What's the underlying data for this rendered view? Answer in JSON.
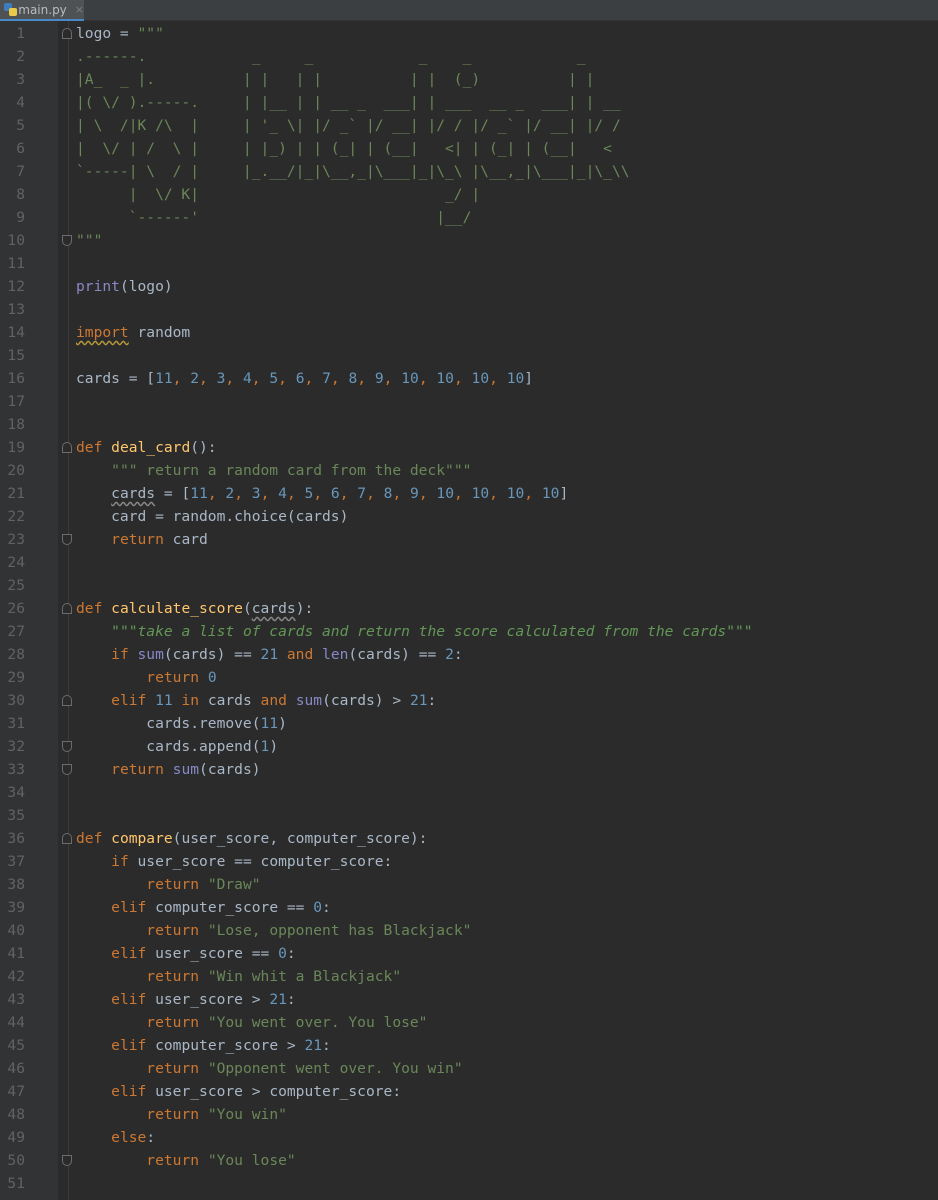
{
  "tab": {
    "filename": "main.py",
    "close": "×",
    "icon": "python-file-icon"
  },
  "lines": [
    {
      "n": "1",
      "segs": [
        [
          "t",
          "logo = "
        ],
        [
          "s",
          "\"\"\""
        ]
      ]
    },
    {
      "n": "2",
      "segs": [
        [
          "s",
          ".------.            _     _            _    _            _"
        ]
      ]
    },
    {
      "n": "3",
      "segs": [
        [
          "s",
          "|A_  _ |.          | |   | |          | |  (_)          | |"
        ]
      ]
    },
    {
      "n": "4",
      "segs": [
        [
          "s",
          "|( \\/ ).-----.     | |__ | | __ _  ___| | ___  __ _  ___| | __"
        ]
      ]
    },
    {
      "n": "5",
      "segs": [
        [
          "s",
          "| \\  /|K /\\  |     | '_ \\| |/ _` |/ __| |/ / |/ _` |/ __| |/ /"
        ]
      ]
    },
    {
      "n": "6",
      "segs": [
        [
          "s",
          "|  \\/ | /  \\ |     | |_) | | (_| | (__|   <| | (_| | (__|   <"
        ]
      ]
    },
    {
      "n": "7",
      "segs": [
        [
          "s",
          "`-----| \\  / |     |_.__/|_|\\__,_|\\___|_|\\_\\ |\\__,_|\\___|_|\\_\\\\"
        ]
      ]
    },
    {
      "n": "8",
      "segs": [
        [
          "s",
          "      |  \\/ K|                            _/ |"
        ]
      ]
    },
    {
      "n": "9",
      "segs": [
        [
          "s",
          "      `------'                           |__/"
        ]
      ]
    },
    {
      "n": "10",
      "segs": [
        [
          "s",
          "\"\"\""
        ]
      ]
    },
    {
      "n": "11",
      "segs": []
    },
    {
      "n": "12",
      "segs": [
        [
          "b",
          "print"
        ],
        [
          "t",
          "(logo)"
        ]
      ]
    },
    {
      "n": "13",
      "segs": []
    },
    {
      "n": "14",
      "segs": [
        [
          "kw-wavy",
          "import"
        ],
        [
          "t",
          " random"
        ]
      ]
    },
    {
      "n": "15",
      "segs": []
    },
    {
      "n": "16",
      "segs": [
        [
          "t",
          "cards = ["
        ],
        [
          "n",
          "11"
        ],
        [
          "k",
          ", "
        ],
        [
          "n",
          "2"
        ],
        [
          "k",
          ", "
        ],
        [
          "n",
          "3"
        ],
        [
          "k",
          ", "
        ],
        [
          "n",
          "4"
        ],
        [
          "k",
          ", "
        ],
        [
          "n",
          "5"
        ],
        [
          "k",
          ", "
        ],
        [
          "n",
          "6"
        ],
        [
          "k",
          ", "
        ],
        [
          "n",
          "7"
        ],
        [
          "k",
          ", "
        ],
        [
          "n",
          "8"
        ],
        [
          "k",
          ", "
        ],
        [
          "n",
          "9"
        ],
        [
          "k",
          ", "
        ],
        [
          "n",
          "10"
        ],
        [
          "k",
          ", "
        ],
        [
          "n",
          "10"
        ],
        [
          "k",
          ", "
        ],
        [
          "n",
          "10"
        ],
        [
          "k",
          ", "
        ],
        [
          "n",
          "10"
        ],
        [
          "t",
          "]"
        ]
      ]
    },
    {
      "n": "17",
      "segs": []
    },
    {
      "n": "18",
      "segs": []
    },
    {
      "n": "19",
      "segs": [
        [
          "k",
          "def "
        ],
        [
          "f",
          "deal_card"
        ],
        [
          "t",
          "():"
        ]
      ]
    },
    {
      "n": "20",
      "segs": [
        [
          "t",
          "    "
        ],
        [
          "s",
          "\"\"\" return a random card from the deck\"\"\""
        ]
      ]
    },
    {
      "n": "21",
      "segs": [
        [
          "t",
          "    "
        ],
        [
          "t-wavy",
          "cards"
        ],
        [
          "t",
          " = ["
        ],
        [
          "n",
          "11"
        ],
        [
          "k",
          ", "
        ],
        [
          "n",
          "2"
        ],
        [
          "k",
          ", "
        ],
        [
          "n",
          "3"
        ],
        [
          "k",
          ", "
        ],
        [
          "n",
          "4"
        ],
        [
          "k",
          ", "
        ],
        [
          "n",
          "5"
        ],
        [
          "k",
          ", "
        ],
        [
          "n",
          "6"
        ],
        [
          "k",
          ", "
        ],
        [
          "n",
          "7"
        ],
        [
          "k",
          ", "
        ],
        [
          "n",
          "8"
        ],
        [
          "k",
          ", "
        ],
        [
          "n",
          "9"
        ],
        [
          "k",
          ", "
        ],
        [
          "n",
          "10"
        ],
        [
          "k",
          ", "
        ],
        [
          "n",
          "10"
        ],
        [
          "k",
          ", "
        ],
        [
          "n",
          "10"
        ],
        [
          "k",
          ", "
        ],
        [
          "n",
          "10"
        ],
        [
          "t",
          "]"
        ]
      ]
    },
    {
      "n": "22",
      "segs": [
        [
          "t",
          "    card = random.choice(cards)"
        ]
      ]
    },
    {
      "n": "23",
      "segs": [
        [
          "t",
          "    "
        ],
        [
          "k",
          "return"
        ],
        [
          "t",
          " card"
        ]
      ]
    },
    {
      "n": "24",
      "segs": []
    },
    {
      "n": "25",
      "segs": []
    },
    {
      "n": "26",
      "segs": [
        [
          "k",
          "def "
        ],
        [
          "f",
          "calculate_score"
        ],
        [
          "t",
          "("
        ],
        [
          "t-wavy",
          "cards"
        ],
        [
          "t",
          "):"
        ]
      ]
    },
    {
      "n": "27",
      "segs": [
        [
          "t",
          "    "
        ],
        [
          "d",
          "\"\"\"take a list of cards and return the score calculated from the cards\"\"\""
        ]
      ]
    },
    {
      "n": "28",
      "segs": [
        [
          "t",
          "    "
        ],
        [
          "k",
          "if "
        ],
        [
          "b",
          "sum"
        ],
        [
          "t",
          "(cards) == "
        ],
        [
          "n",
          "21"
        ],
        [
          "k",
          " and "
        ],
        [
          "b",
          "len"
        ],
        [
          "t",
          "(cards) == "
        ],
        [
          "n",
          "2"
        ],
        [
          "t",
          ":"
        ]
      ]
    },
    {
      "n": "29",
      "segs": [
        [
          "t",
          "        "
        ],
        [
          "k",
          "return "
        ],
        [
          "n",
          "0"
        ]
      ]
    },
    {
      "n": "30",
      "segs": [
        [
          "t",
          "    "
        ],
        [
          "k",
          "elif "
        ],
        [
          "n",
          "11"
        ],
        [
          "k",
          " in"
        ],
        [
          "t",
          " cards "
        ],
        [
          "k",
          "and "
        ],
        [
          "b",
          "sum"
        ],
        [
          "t",
          "(cards) > "
        ],
        [
          "n",
          "21"
        ],
        [
          "t",
          ":"
        ]
      ]
    },
    {
      "n": "31",
      "segs": [
        [
          "t",
          "        cards.remove("
        ],
        [
          "n",
          "11"
        ],
        [
          "t",
          ")"
        ]
      ]
    },
    {
      "n": "32",
      "segs": [
        [
          "t",
          "        cards.append("
        ],
        [
          "n",
          "1"
        ],
        [
          "t",
          ")"
        ]
      ]
    },
    {
      "n": "33",
      "segs": [
        [
          "t",
          "    "
        ],
        [
          "k",
          "return "
        ],
        [
          "b",
          "sum"
        ],
        [
          "t",
          "(cards)"
        ]
      ]
    },
    {
      "n": "34",
      "segs": []
    },
    {
      "n": "35",
      "segs": []
    },
    {
      "n": "36",
      "segs": [
        [
          "k",
          "def "
        ],
        [
          "f",
          "compare"
        ],
        [
          "t",
          "(user_score, computer_score):"
        ]
      ]
    },
    {
      "n": "37",
      "segs": [
        [
          "t",
          "    "
        ],
        [
          "k",
          "if"
        ],
        [
          "t",
          " user_score == computer_score:"
        ]
      ]
    },
    {
      "n": "38",
      "segs": [
        [
          "t",
          "        "
        ],
        [
          "k",
          "return "
        ],
        [
          "s",
          "\"Draw\""
        ]
      ]
    },
    {
      "n": "39",
      "segs": [
        [
          "t",
          "    "
        ],
        [
          "k",
          "elif"
        ],
        [
          "t",
          " computer_score == "
        ],
        [
          "n",
          "0"
        ],
        [
          "t",
          ":"
        ]
      ]
    },
    {
      "n": "40",
      "segs": [
        [
          "t",
          "        "
        ],
        [
          "k",
          "return "
        ],
        [
          "s",
          "\"Lose, opponent has Blackjack\""
        ]
      ]
    },
    {
      "n": "41",
      "segs": [
        [
          "t",
          "    "
        ],
        [
          "k",
          "elif"
        ],
        [
          "t",
          " user_score == "
        ],
        [
          "n",
          "0"
        ],
        [
          "t",
          ":"
        ]
      ]
    },
    {
      "n": "42",
      "segs": [
        [
          "t",
          "        "
        ],
        [
          "k",
          "return "
        ],
        [
          "s",
          "\"Win whit a Blackjack\""
        ]
      ]
    },
    {
      "n": "43",
      "segs": [
        [
          "t",
          "    "
        ],
        [
          "k",
          "elif"
        ],
        [
          "t",
          " user_score > "
        ],
        [
          "n",
          "21"
        ],
        [
          "t",
          ":"
        ]
      ]
    },
    {
      "n": "44",
      "segs": [
        [
          "t",
          "        "
        ],
        [
          "k",
          "return "
        ],
        [
          "s",
          "\"You went over. You lose\""
        ]
      ]
    },
    {
      "n": "45",
      "segs": [
        [
          "t",
          "    "
        ],
        [
          "k",
          "elif"
        ],
        [
          "t",
          " computer_score > "
        ],
        [
          "n",
          "21"
        ],
        [
          "t",
          ":"
        ]
      ]
    },
    {
      "n": "46",
      "segs": [
        [
          "t",
          "        "
        ],
        [
          "k",
          "return "
        ],
        [
          "s",
          "\"Opponent went over. You win\""
        ]
      ]
    },
    {
      "n": "47",
      "segs": [
        [
          "t",
          "    "
        ],
        [
          "k",
          "elif"
        ],
        [
          "t",
          " user_score > computer_score:"
        ]
      ]
    },
    {
      "n": "48",
      "segs": [
        [
          "t",
          "        "
        ],
        [
          "k",
          "return "
        ],
        [
          "s",
          "\"You win\""
        ]
      ]
    },
    {
      "n": "49",
      "segs": [
        [
          "t",
          "    "
        ],
        [
          "k",
          "else"
        ],
        [
          "t",
          ":"
        ]
      ]
    },
    {
      "n": "50",
      "segs": [
        [
          "t",
          "        "
        ],
        [
          "k",
          "return "
        ],
        [
          "s",
          "\"You lose\""
        ]
      ]
    },
    {
      "n": "51",
      "segs": []
    }
  ],
  "colors": {
    "background": "#2b2b2b",
    "keyword": "#cc7832",
    "number": "#6897bb",
    "string": "#6a8759",
    "function": "#ffc66d",
    "builtin": "#8888c6",
    "text": "#a9b7c6"
  }
}
